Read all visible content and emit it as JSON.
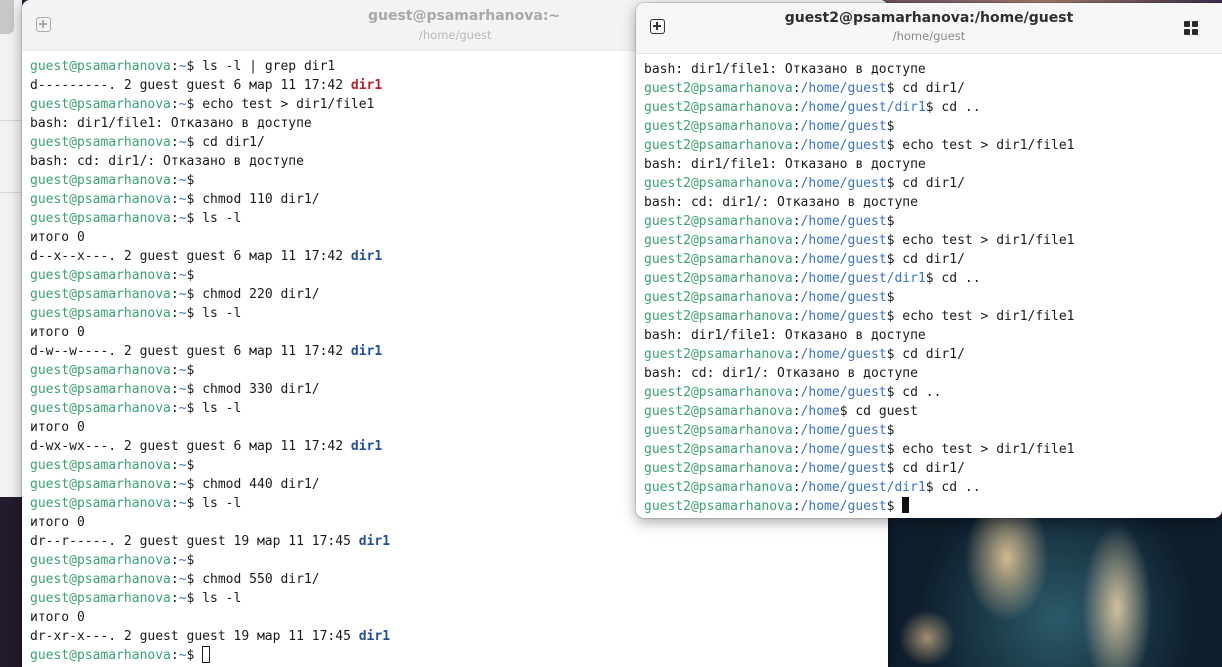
{
  "window1": {
    "title": "guest@psamarhanova:~",
    "subtitle": "/home/guest",
    "lines": [
      [
        {
          "t": "guest@psamarhanova",
          "c": "u"
        },
        {
          "t": ":"
        },
        {
          "t": "~",
          "c": "p"
        },
        {
          "t": "$ ls -l | grep dir1"
        }
      ],
      [
        {
          "t": "d---------. 2 guest guest 6 мар 11 17:42 "
        },
        {
          "t": "dir1",
          "c": "dir-red"
        }
      ],
      [
        {
          "t": "guest@psamarhanova",
          "c": "u"
        },
        {
          "t": ":"
        },
        {
          "t": "~",
          "c": "p"
        },
        {
          "t": "$ echo test > dir1/file1"
        }
      ],
      [
        {
          "t": "bash: dir1/file1: Отказано в доступе"
        }
      ],
      [
        {
          "t": "guest@psamarhanova",
          "c": "u"
        },
        {
          "t": ":"
        },
        {
          "t": "~",
          "c": "p"
        },
        {
          "t": "$ cd dir1/"
        }
      ],
      [
        {
          "t": "bash: cd: dir1/: Отказано в доступе"
        }
      ],
      [
        {
          "t": "guest@psamarhanova",
          "c": "u"
        },
        {
          "t": ":"
        },
        {
          "t": "~",
          "c": "p"
        },
        {
          "t": "$"
        }
      ],
      [
        {
          "t": "guest@psamarhanova",
          "c": "u"
        },
        {
          "t": ":"
        },
        {
          "t": "~",
          "c": "p"
        },
        {
          "t": "$ chmod 110 dir1/"
        }
      ],
      [
        {
          "t": "guest@psamarhanova",
          "c": "u"
        },
        {
          "t": ":"
        },
        {
          "t": "~",
          "c": "p"
        },
        {
          "t": "$ ls -l"
        }
      ],
      [
        {
          "t": "итого 0"
        }
      ],
      [
        {
          "t": "d--x--x---. 2 guest guest 6 мар 11 17:42 "
        },
        {
          "t": "dir1",
          "c": "dir-blue"
        }
      ],
      [
        {
          "t": "guest@psamarhanova",
          "c": "u"
        },
        {
          "t": ":"
        },
        {
          "t": "~",
          "c": "p"
        },
        {
          "t": "$"
        }
      ],
      [
        {
          "t": "guest@psamarhanova",
          "c": "u"
        },
        {
          "t": ":"
        },
        {
          "t": "~",
          "c": "p"
        },
        {
          "t": "$ chmod 220 dir1/"
        }
      ],
      [
        {
          "t": "guest@psamarhanova",
          "c": "u"
        },
        {
          "t": ":"
        },
        {
          "t": "~",
          "c": "p"
        },
        {
          "t": "$ ls -l"
        }
      ],
      [
        {
          "t": "итого 0"
        }
      ],
      [
        {
          "t": "d-w--w----. 2 guest guest 6 мар 11 17:42 "
        },
        {
          "t": "dir1",
          "c": "dir-blue"
        }
      ],
      [
        {
          "t": "guest@psamarhanova",
          "c": "u"
        },
        {
          "t": ":"
        },
        {
          "t": "~",
          "c": "p"
        },
        {
          "t": "$"
        }
      ],
      [
        {
          "t": "guest@psamarhanova",
          "c": "u"
        },
        {
          "t": ":"
        },
        {
          "t": "~",
          "c": "p"
        },
        {
          "t": "$ chmod 330 dir1/"
        }
      ],
      [
        {
          "t": "guest@psamarhanova",
          "c": "u"
        },
        {
          "t": ":"
        },
        {
          "t": "~",
          "c": "p"
        },
        {
          "t": "$ ls -l"
        }
      ],
      [
        {
          "t": "итого 0"
        }
      ],
      [
        {
          "t": "d-wx-wx---. 2 guest guest 6 мар 11 17:42 "
        },
        {
          "t": "dir1",
          "c": "dir-blue"
        }
      ],
      [
        {
          "t": "guest@psamarhanova",
          "c": "u"
        },
        {
          "t": ":"
        },
        {
          "t": "~",
          "c": "p"
        },
        {
          "t": "$"
        }
      ],
      [
        {
          "t": "guest@psamarhanova",
          "c": "u"
        },
        {
          "t": ":"
        },
        {
          "t": "~",
          "c": "p"
        },
        {
          "t": "$ chmod 440 dir1/"
        }
      ],
      [
        {
          "t": "guest@psamarhanova",
          "c": "u"
        },
        {
          "t": ":"
        },
        {
          "t": "~",
          "c": "p"
        },
        {
          "t": "$ ls -l"
        }
      ],
      [
        {
          "t": "итого 0"
        }
      ],
      [
        {
          "t": "dr--r-----. 2 guest guest 19 мар 11 17:45 "
        },
        {
          "t": "dir1",
          "c": "dir-blue"
        }
      ],
      [
        {
          "t": "guest@psamarhanova",
          "c": "u"
        },
        {
          "t": ":"
        },
        {
          "t": "~",
          "c": "p"
        },
        {
          "t": "$"
        }
      ],
      [
        {
          "t": "guest@psamarhanova",
          "c": "u"
        },
        {
          "t": ":"
        },
        {
          "t": "~",
          "c": "p"
        },
        {
          "t": "$ chmod 550 dir1/"
        }
      ],
      [
        {
          "t": "guest@psamarhanova",
          "c": "u"
        },
        {
          "t": ":"
        },
        {
          "t": "~",
          "c": "p"
        },
        {
          "t": "$ ls -l"
        }
      ],
      [
        {
          "t": "итого 0"
        }
      ],
      [
        {
          "t": "dr-xr-x---. 2 guest guest 19 мар 11 17:45 "
        },
        {
          "t": "dir1",
          "c": "dir-blue"
        }
      ],
      [
        {
          "t": "guest@psamarhanova",
          "c": "u"
        },
        {
          "t": ":"
        },
        {
          "t": "~",
          "c": "p"
        },
        {
          "t": "$ "
        },
        {
          "cursor": "hollow"
        }
      ]
    ]
  },
  "window2": {
    "title": "guest2@psamarhanova:/home/guest",
    "subtitle": "/home/guest",
    "lines": [
      [
        {
          "t": "bash: dir1/file1: Отказано в доступе"
        }
      ],
      [
        {
          "t": "guest2@psamarhanova",
          "c": "u"
        },
        {
          "t": ":"
        },
        {
          "t": "/home/guest",
          "c": "p"
        },
        {
          "t": "$ cd dir1/"
        }
      ],
      [
        {
          "t": "guest2@psamarhanova",
          "c": "u"
        },
        {
          "t": ":"
        },
        {
          "t": "/home/guest/dir1",
          "c": "p"
        },
        {
          "t": "$ cd .."
        }
      ],
      [
        {
          "t": "guest2@psamarhanova",
          "c": "u"
        },
        {
          "t": ":"
        },
        {
          "t": "/home/guest",
          "c": "p"
        },
        {
          "t": "$"
        }
      ],
      [
        {
          "t": "guest2@psamarhanova",
          "c": "u"
        },
        {
          "t": ":"
        },
        {
          "t": "/home/guest",
          "c": "p"
        },
        {
          "t": "$ echo test > dir1/file1"
        }
      ],
      [
        {
          "t": "bash: dir1/file1: Отказано в доступе"
        }
      ],
      [
        {
          "t": "guest2@psamarhanova",
          "c": "u"
        },
        {
          "t": ":"
        },
        {
          "t": "/home/guest",
          "c": "p"
        },
        {
          "t": "$ cd dir1/"
        }
      ],
      [
        {
          "t": "bash: cd: dir1/: Отказано в доступе"
        }
      ],
      [
        {
          "t": "guest2@psamarhanova",
          "c": "u"
        },
        {
          "t": ":"
        },
        {
          "t": "/home/guest",
          "c": "p"
        },
        {
          "t": "$"
        }
      ],
      [
        {
          "t": "guest2@psamarhanova",
          "c": "u"
        },
        {
          "t": ":"
        },
        {
          "t": "/home/guest",
          "c": "p"
        },
        {
          "t": "$ echo test > dir1/file1"
        }
      ],
      [
        {
          "t": "guest2@psamarhanova",
          "c": "u"
        },
        {
          "t": ":"
        },
        {
          "t": "/home/guest",
          "c": "p"
        },
        {
          "t": "$ cd dir1/"
        }
      ],
      [
        {
          "t": "guest2@psamarhanova",
          "c": "u"
        },
        {
          "t": ":"
        },
        {
          "t": "/home/guest/dir1",
          "c": "p"
        },
        {
          "t": "$ cd .."
        }
      ],
      [
        {
          "t": "guest2@psamarhanova",
          "c": "u"
        },
        {
          "t": ":"
        },
        {
          "t": "/home/guest",
          "c": "p"
        },
        {
          "t": "$"
        }
      ],
      [
        {
          "t": "guest2@psamarhanova",
          "c": "u"
        },
        {
          "t": ":"
        },
        {
          "t": "/home/guest",
          "c": "p"
        },
        {
          "t": "$ echo test > dir1/file1"
        }
      ],
      [
        {
          "t": "bash: dir1/file1: Отказано в доступе"
        }
      ],
      [
        {
          "t": "guest2@psamarhanova",
          "c": "u"
        },
        {
          "t": ":"
        },
        {
          "t": "/home/guest",
          "c": "p"
        },
        {
          "t": "$ cd dir1/"
        }
      ],
      [
        {
          "t": "bash: cd: dir1/: Отказано в доступе"
        }
      ],
      [
        {
          "t": "guest2@psamarhanova",
          "c": "u"
        },
        {
          "t": ":"
        },
        {
          "t": "/home/guest",
          "c": "p"
        },
        {
          "t": "$ cd .."
        }
      ],
      [
        {
          "t": "guest2@psamarhanova",
          "c": "u"
        },
        {
          "t": ":"
        },
        {
          "t": "/home",
          "c": "p"
        },
        {
          "t": "$ cd guest"
        }
      ],
      [
        {
          "t": "guest2@psamarhanova",
          "c": "u"
        },
        {
          "t": ":"
        },
        {
          "t": "/home/guest",
          "c": "p"
        },
        {
          "t": "$"
        }
      ],
      [
        {
          "t": "guest2@psamarhanova",
          "c": "u"
        },
        {
          "t": ":"
        },
        {
          "t": "/home/guest",
          "c": "p"
        },
        {
          "t": "$ echo test > dir1/file1"
        }
      ],
      [
        {
          "t": "guest2@psamarhanova",
          "c": "u"
        },
        {
          "t": ":"
        },
        {
          "t": "/home/guest",
          "c": "p"
        },
        {
          "t": "$ cd dir1/"
        }
      ],
      [
        {
          "t": "guest2@psamarhanova",
          "c": "u"
        },
        {
          "t": ":"
        },
        {
          "t": "/home/guest/dir1",
          "c": "p"
        },
        {
          "t": "$ cd .."
        }
      ],
      [
        {
          "t": "guest2@psamarhanova",
          "c": "u"
        },
        {
          "t": ":"
        },
        {
          "t": "/home/guest",
          "c": "p"
        },
        {
          "t": "$ "
        },
        {
          "cursor": "solid"
        }
      ]
    ]
  },
  "icons": {
    "new_tab": "new-tab-icon",
    "menu_grid": "grid-menu-icon"
  },
  "colors": {
    "user_host": "#3aa56f",
    "path": "#3b74c4",
    "dir_no_perm": "#c01c28",
    "dir_perm": "#1f4f9a",
    "terminal_bg": "#ffffff",
    "terminal_fg": "#1a1a1a"
  }
}
